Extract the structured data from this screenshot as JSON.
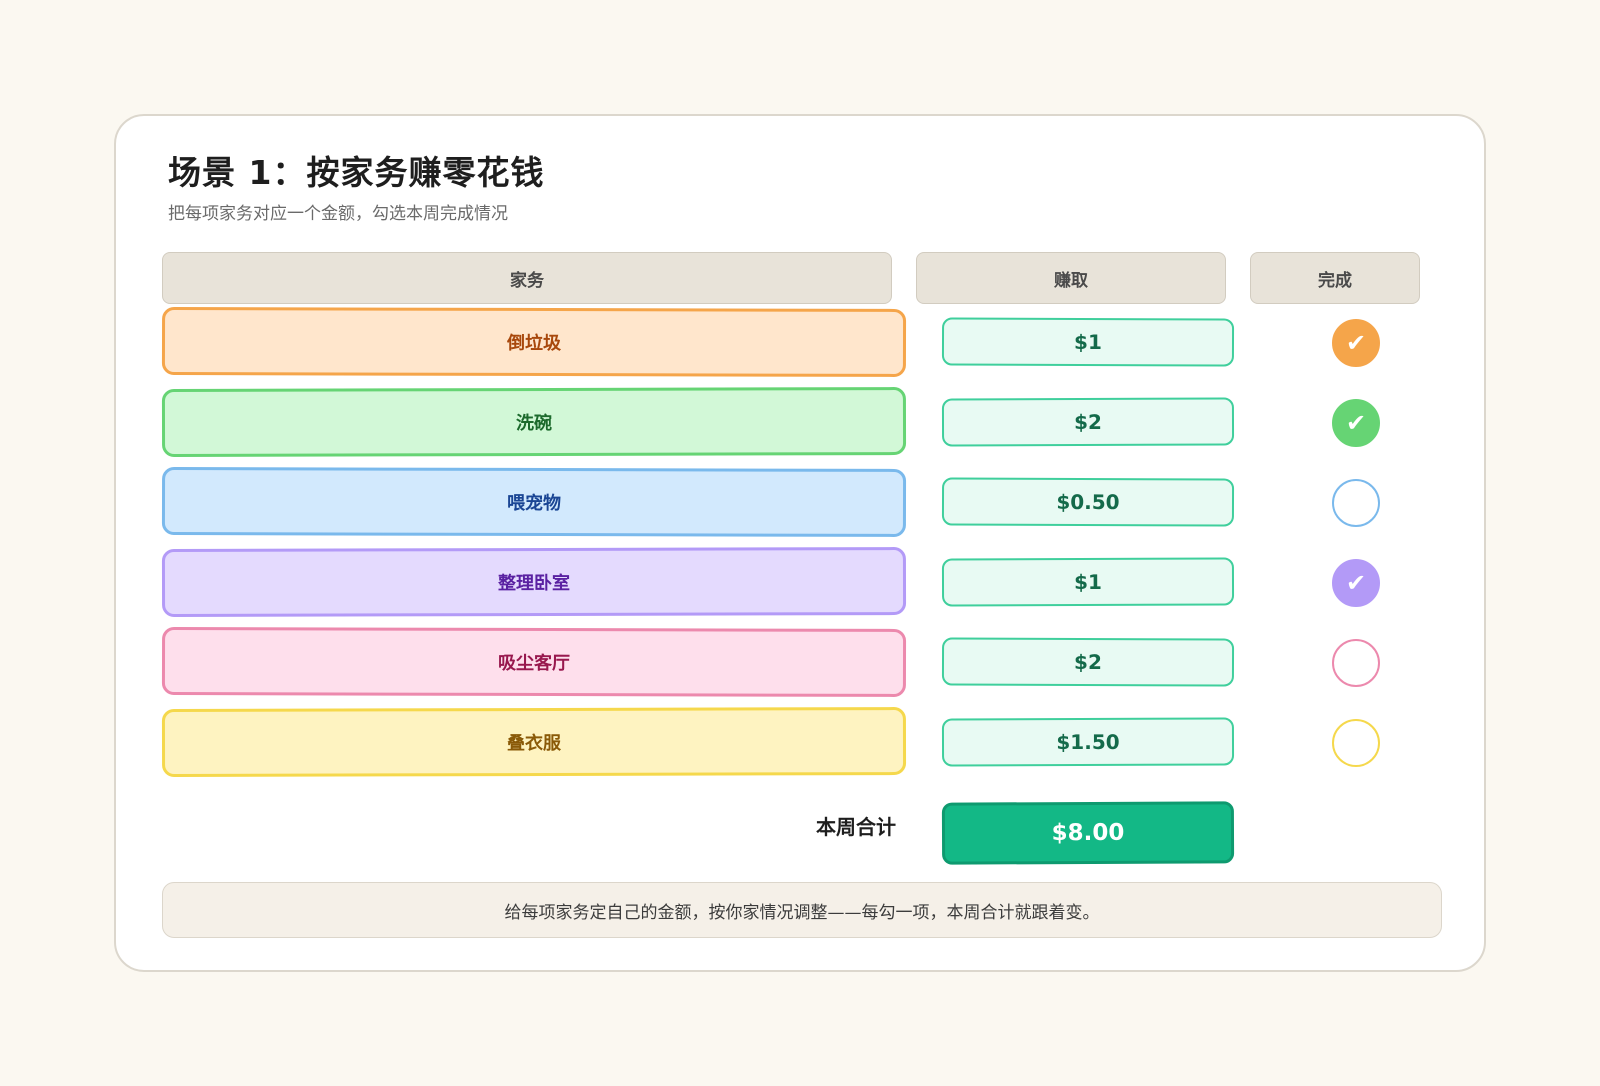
{
  "header": {
    "title": "场景 1：按家务赚零花钱",
    "subtitle": "把每项家务对应一个金额，勾选本周完成情况"
  },
  "columns": {
    "chore": "家务",
    "earn": "赚取",
    "done": "完成"
  },
  "rows": [
    {
      "chore": "倒垃圾",
      "amount": "$1",
      "done": true,
      "check_glyph": "✔",
      "bg": "#ffe6cc",
      "border": "#f5a54a",
      "text": "#a8480c"
    },
    {
      "chore": "洗碗",
      "amount": "$2",
      "done": true,
      "check_glyph": "✔",
      "bg": "#d2f8d7",
      "border": "#66d474",
      "text": "#1c6a2c"
    },
    {
      "chore": "喂宠物",
      "amount": "$0.50",
      "done": false,
      "check_glyph": "",
      "bg": "#d2e9fd",
      "border": "#7ab9ec",
      "text": "#1a4594"
    },
    {
      "chore": "整理卧室",
      "amount": "$1",
      "done": true,
      "check_glyph": "✔",
      "bg": "#e4dafe",
      "border": "#b39af7",
      "text": "#5a21a2"
    },
    {
      "chore": "吸尘客厅",
      "amount": "$2",
      "done": false,
      "check_glyph": "",
      "bg": "#fedfec",
      "border": "#ec89ad",
      "text": "#98184e"
    },
    {
      "chore": "叠衣服",
      "amount": "$1.50",
      "done": false,
      "check_glyph": "",
      "bg": "#fef3c1",
      "border": "#f5d84c",
      "text": "#8a5a08"
    }
  ],
  "total": {
    "label": "本周合计",
    "value": "$8.00"
  },
  "note": "给每项家务定自己的金额，按你家情况调整——每勾一项，本周合计就跟着变。"
}
